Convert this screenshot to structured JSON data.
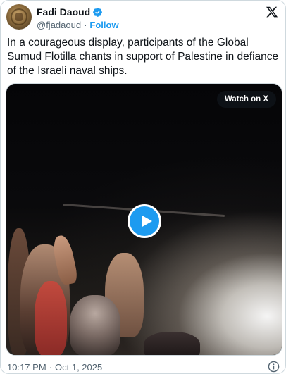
{
  "author": {
    "name": "Fadi Daoud",
    "handle": "@fjadaoud",
    "follow_label": "Follow",
    "separator": "·",
    "verified": true,
    "avatar_icon": "avatar-coin-icon"
  },
  "platform_logo": "x-logo-icon",
  "tweet": {
    "text": "In a courageous display, participants of the Global Sumud Flotilla chants in support of Palestine in defiance of the Israeli naval ships."
  },
  "media": {
    "watch_label": "Watch on X",
    "play_icon": "play-icon"
  },
  "footer": {
    "time": "10:17 PM",
    "separator": "·",
    "date": "Oct 1, 2025",
    "info_icon": "info-icon"
  },
  "colors": {
    "accent": "#1d9bf0",
    "text": "#0f1419",
    "muted": "#536471",
    "border": "#cfd9de"
  }
}
